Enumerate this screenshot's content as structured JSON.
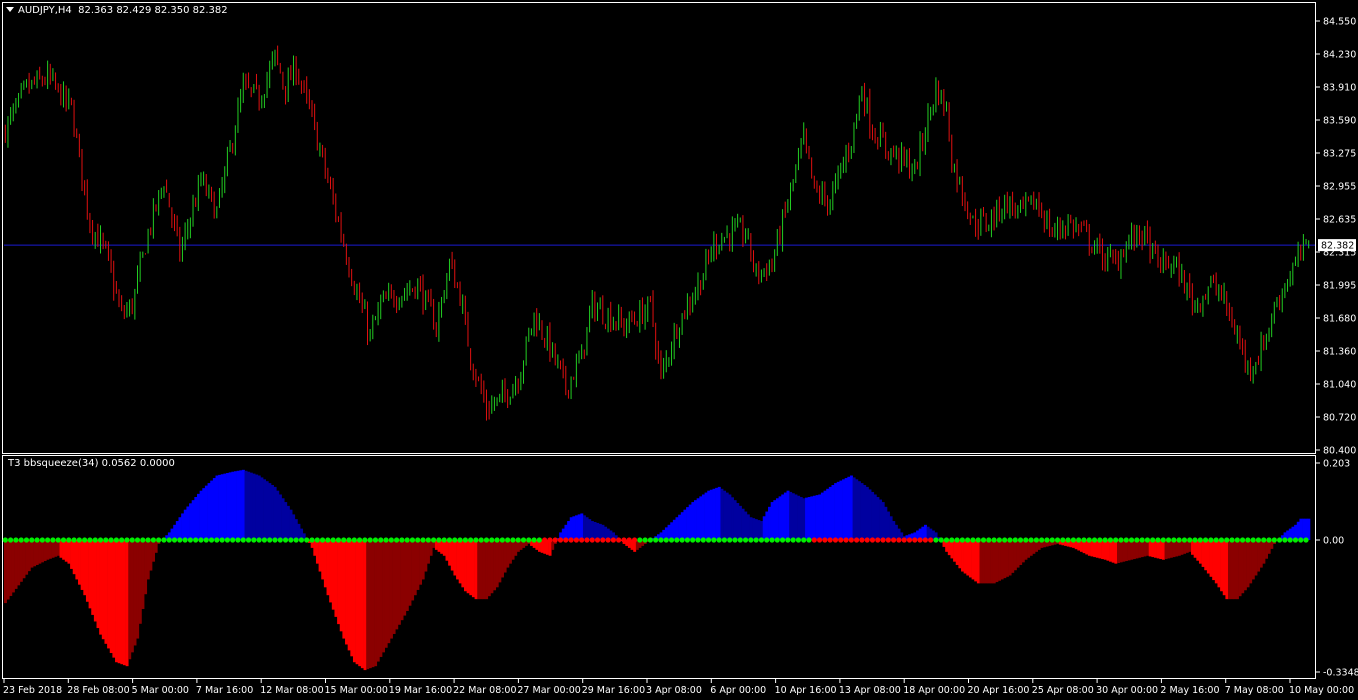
{
  "colors": {
    "background": "#000000",
    "frame": "#ffffff",
    "text": "#ffffff",
    "bull_candle": "#22cc22",
    "bear_candle": "#e01010",
    "bid_line": "#1a1ad0",
    "price_marker_bg": "#ffffff",
    "price_marker_text": "#000000",
    "hist_blue_bright": "#0000ff",
    "hist_blue_dark": "#0000a0",
    "hist_red_bright": "#ff0000",
    "hist_red_dark": "#8b0000",
    "dot_green": "#00ee00",
    "dot_red": "#ff0000"
  },
  "main_pane": {
    "symbol_menu_icon": "triangle-down-icon",
    "header": "AUDJPY,H4  82.363 82.429 82.350 82.382",
    "current_price_label": "82.382",
    "current_price": 82.382,
    "price_axis_ticks": [
      "84.550",
      "84.230",
      "83.910",
      "83.590",
      "83.275",
      "82.955",
      "82.635",
      "82.315",
      "81.995",
      "81.680",
      "81.360",
      "81.040",
      "80.720",
      "80.400"
    ]
  },
  "indicator_pane": {
    "header": "T3 bbsqueeze(34) 0.0562 0.0000",
    "axis_ticks": [
      "0.203",
      "0.00",
      "-0.3348"
    ]
  },
  "time_axis_labels": [
    "23 Feb 2018",
    "28 Feb 08:00",
    "5 Mar 00:00",
    "7 Mar 16:00",
    "12 Mar 08:00",
    "15 Mar 00:00",
    "19 Mar 16:00",
    "22 Mar 08:00",
    "27 Mar 00:00",
    "29 Mar 16:00",
    "3 Apr 08:00",
    "6 Apr 00:00",
    "10 Apr 16:00",
    "13 Apr 08:00",
    "18 Apr 00:00",
    "20 Apr 16:00",
    "25 Apr 08:00",
    "30 Apr 00:00",
    "2 May 16:00",
    "7 May 08:00",
    "10 May 00:00"
  ],
  "chart_data": [
    {
      "type": "candlestick",
      "title": "AUDJPY,H4",
      "ylim": [
        80.4,
        84.55
      ],
      "close_path": [
        [
          0,
          83.5
        ],
        [
          8,
          83.9
        ],
        [
          16,
          84.0
        ],
        [
          25,
          83.7
        ],
        [
          32,
          82.6
        ],
        [
          38,
          82.3
        ],
        [
          44,
          81.7
        ],
        [
          48,
          81.8
        ],
        [
          54,
          82.5
        ],
        [
          60,
          83.0
        ],
        [
          66,
          82.3
        ],
        [
          74,
          83.0
        ],
        [
          80,
          82.7
        ],
        [
          85,
          83.3
        ],
        [
          90,
          83.9
        ],
        [
          96,
          83.8
        ],
        [
          102,
          84.2
        ],
        [
          106,
          83.9
        ],
        [
          110,
          84.1
        ],
        [
          116,
          83.6
        ],
        [
          124,
          82.8
        ],
        [
          132,
          82.0
        ],
        [
          138,
          81.5
        ],
        [
          142,
          81.8
        ],
        [
          148,
          81.9
        ],
        [
          156,
          82.0
        ],
        [
          163,
          81.6
        ],
        [
          168,
          82.2
        ],
        [
          172,
          81.9
        ],
        [
          176,
          81.3
        ],
        [
          182,
          80.8
        ],
        [
          188,
          80.9
        ],
        [
          194,
          81.1
        ],
        [
          200,
          81.7
        ],
        [
          206,
          81.4
        ],
        [
          212,
          81.0
        ],
        [
          218,
          81.3
        ],
        [
          222,
          81.8
        ],
        [
          228,
          81.7
        ],
        [
          234,
          81.6
        ],
        [
          240,
          81.7
        ],
        [
          244,
          81.8
        ],
        [
          248,
          81.1
        ],
        [
          254,
          81.6
        ],
        [
          258,
          81.8
        ],
        [
          264,
          82.1
        ],
        [
          268,
          82.4
        ],
        [
          274,
          82.5
        ],
        [
          280,
          82.5
        ],
        [
          284,
          82.1
        ],
        [
          290,
          82.2
        ],
        [
          296,
          82.8
        ],
        [
          302,
          83.4
        ],
        [
          306,
          82.9
        ],
        [
          312,
          82.8
        ],
        [
          316,
          83.1
        ],
        [
          320,
          83.4
        ],
        [
          324,
          83.9
        ],
        [
          328,
          83.5
        ],
        [
          334,
          83.3
        ],
        [
          340,
          83.2
        ],
        [
          344,
          83.1
        ],
        [
          348,
          83.5
        ],
        [
          352,
          83.9
        ],
        [
          356,
          83.7
        ],
        [
          358,
          83.2
        ],
        [
          362,
          82.9
        ],
        [
          366,
          82.6
        ],
        [
          372,
          82.6
        ],
        [
          378,
          82.8
        ],
        [
          384,
          82.7
        ],
        [
          390,
          82.8
        ],
        [
          396,
          82.5
        ],
        [
          402,
          82.6
        ],
        [
          408,
          82.5
        ],
        [
          414,
          82.3
        ],
        [
          420,
          82.2
        ],
        [
          424,
          82.4
        ],
        [
          430,
          82.5
        ],
        [
          436,
          82.2
        ],
        [
          442,
          82.2
        ],
        [
          446,
          82.0
        ],
        [
          450,
          81.8
        ],
        [
          456,
          82.0
        ],
        [
          460,
          81.9
        ],
        [
          466,
          81.5
        ],
        [
          470,
          81.2
        ],
        [
          474,
          81.3
        ],
        [
          478,
          81.6
        ],
        [
          482,
          81.9
        ],
        [
          486,
          82.1
        ],
        [
          490,
          82.3
        ],
        [
          493,
          82.382
        ]
      ],
      "series": [
        {
          "name": "AUDJPY,H4",
          "last_values": {
            "open": 82.363,
            "high": 82.429,
            "low": 82.35,
            "close": 82.382
          }
        }
      ]
    },
    {
      "type": "histogram",
      "title": "T3 bbsqueeze(34)",
      "last_values": [
        0.0562,
        0.0
      ],
      "ylim": [
        -0.3348,
        0.203
      ],
      "momentum_path": [
        [
          0,
          -0.16
        ],
        [
          10,
          -0.07
        ],
        [
          16,
          -0.05
        ],
        [
          20,
          -0.04
        ],
        [
          24,
          -0.06
        ],
        [
          30,
          -0.14
        ],
        [
          36,
          -0.24
        ],
        [
          42,
          -0.31
        ],
        [
          46,
          -0.32
        ],
        [
          50,
          -0.25
        ],
        [
          54,
          -0.1
        ],
        [
          58,
          -0.01
        ],
        [
          62,
          0.02
        ],
        [
          68,
          0.08
        ],
        [
          74,
          0.13
        ],
        [
          80,
          0.17
        ],
        [
          86,
          0.18
        ],
        [
          90,
          0.185
        ],
        [
          96,
          0.17
        ],
        [
          102,
          0.14
        ],
        [
          108,
          0.08
        ],
        [
          112,
          0.03
        ],
        [
          116,
          -0.02
        ],
        [
          122,
          -0.14
        ],
        [
          128,
          -0.25
        ],
        [
          132,
          -0.31
        ],
        [
          136,
          -0.33
        ],
        [
          140,
          -0.32
        ],
        [
          146,
          -0.25
        ],
        [
          152,
          -0.18
        ],
        [
          158,
          -0.1
        ],
        [
          162,
          -0.02
        ],
        [
          166,
          -0.04
        ],
        [
          170,
          -0.09
        ],
        [
          174,
          -0.13
        ],
        [
          178,
          -0.15
        ],
        [
          182,
          -0.15
        ],
        [
          186,
          -0.12
        ],
        [
          190,
          -0.07
        ],
        [
          194,
          -0.03
        ],
        [
          198,
          -0.01
        ],
        [
          202,
          -0.03
        ],
        [
          206,
          -0.04
        ],
        [
          210,
          0.02
        ],
        [
          214,
          0.06
        ],
        [
          218,
          0.07
        ],
        [
          222,
          0.05
        ],
        [
          226,
          0.04
        ],
        [
          230,
          0.02
        ],
        [
          234,
          -0.01
        ],
        [
          238,
          -0.03
        ],
        [
          244,
          0.0
        ],
        [
          248,
          0.02
        ],
        [
          254,
          0.06
        ],
        [
          260,
          0.1
        ],
        [
          266,
          0.13
        ],
        [
          270,
          0.14
        ],
        [
          274,
          0.12
        ],
        [
          278,
          0.09
        ],
        [
          282,
          0.06
        ],
        [
          286,
          0.05
        ],
        [
          290,
          0.1
        ],
        [
          296,
          0.13
        ],
        [
          302,
          0.11
        ],
        [
          308,
          0.12
        ],
        [
          314,
          0.15
        ],
        [
          320,
          0.17
        ],
        [
          326,
          0.14
        ],
        [
          332,
          0.1
        ],
        [
          336,
          0.05
        ],
        [
          340,
          0.01
        ],
        [
          344,
          0.02
        ],
        [
          348,
          0.04
        ],
        [
          352,
          0.02
        ],
        [
          356,
          -0.03
        ],
        [
          362,
          -0.08
        ],
        [
          368,
          -0.11
        ],
        [
          374,
          -0.11
        ],
        [
          380,
          -0.09
        ],
        [
          386,
          -0.05
        ],
        [
          392,
          -0.02
        ],
        [
          398,
          -0.01
        ],
        [
          404,
          -0.02
        ],
        [
          410,
          -0.04
        ],
        [
          416,
          -0.05
        ],
        [
          420,
          -0.06
        ],
        [
          426,
          -0.05
        ],
        [
          432,
          -0.04
        ],
        [
          438,
          -0.05
        ],
        [
          444,
          -0.04
        ],
        [
          448,
          -0.03
        ],
        [
          452,
          -0.06
        ],
        [
          458,
          -0.11
        ],
        [
          462,
          -0.15
        ],
        [
          466,
          -0.15
        ],
        [
          470,
          -0.12
        ],
        [
          476,
          -0.06
        ],
        [
          480,
          -0.01
        ],
        [
          484,
          0.02
        ],
        [
          488,
          0.04
        ],
        [
          490,
          0.0562
        ]
      ],
      "squeeze_dots_red_ranges": [
        [
          203,
          238
        ],
        [
          306,
          350
        ]
      ]
    }
  ]
}
